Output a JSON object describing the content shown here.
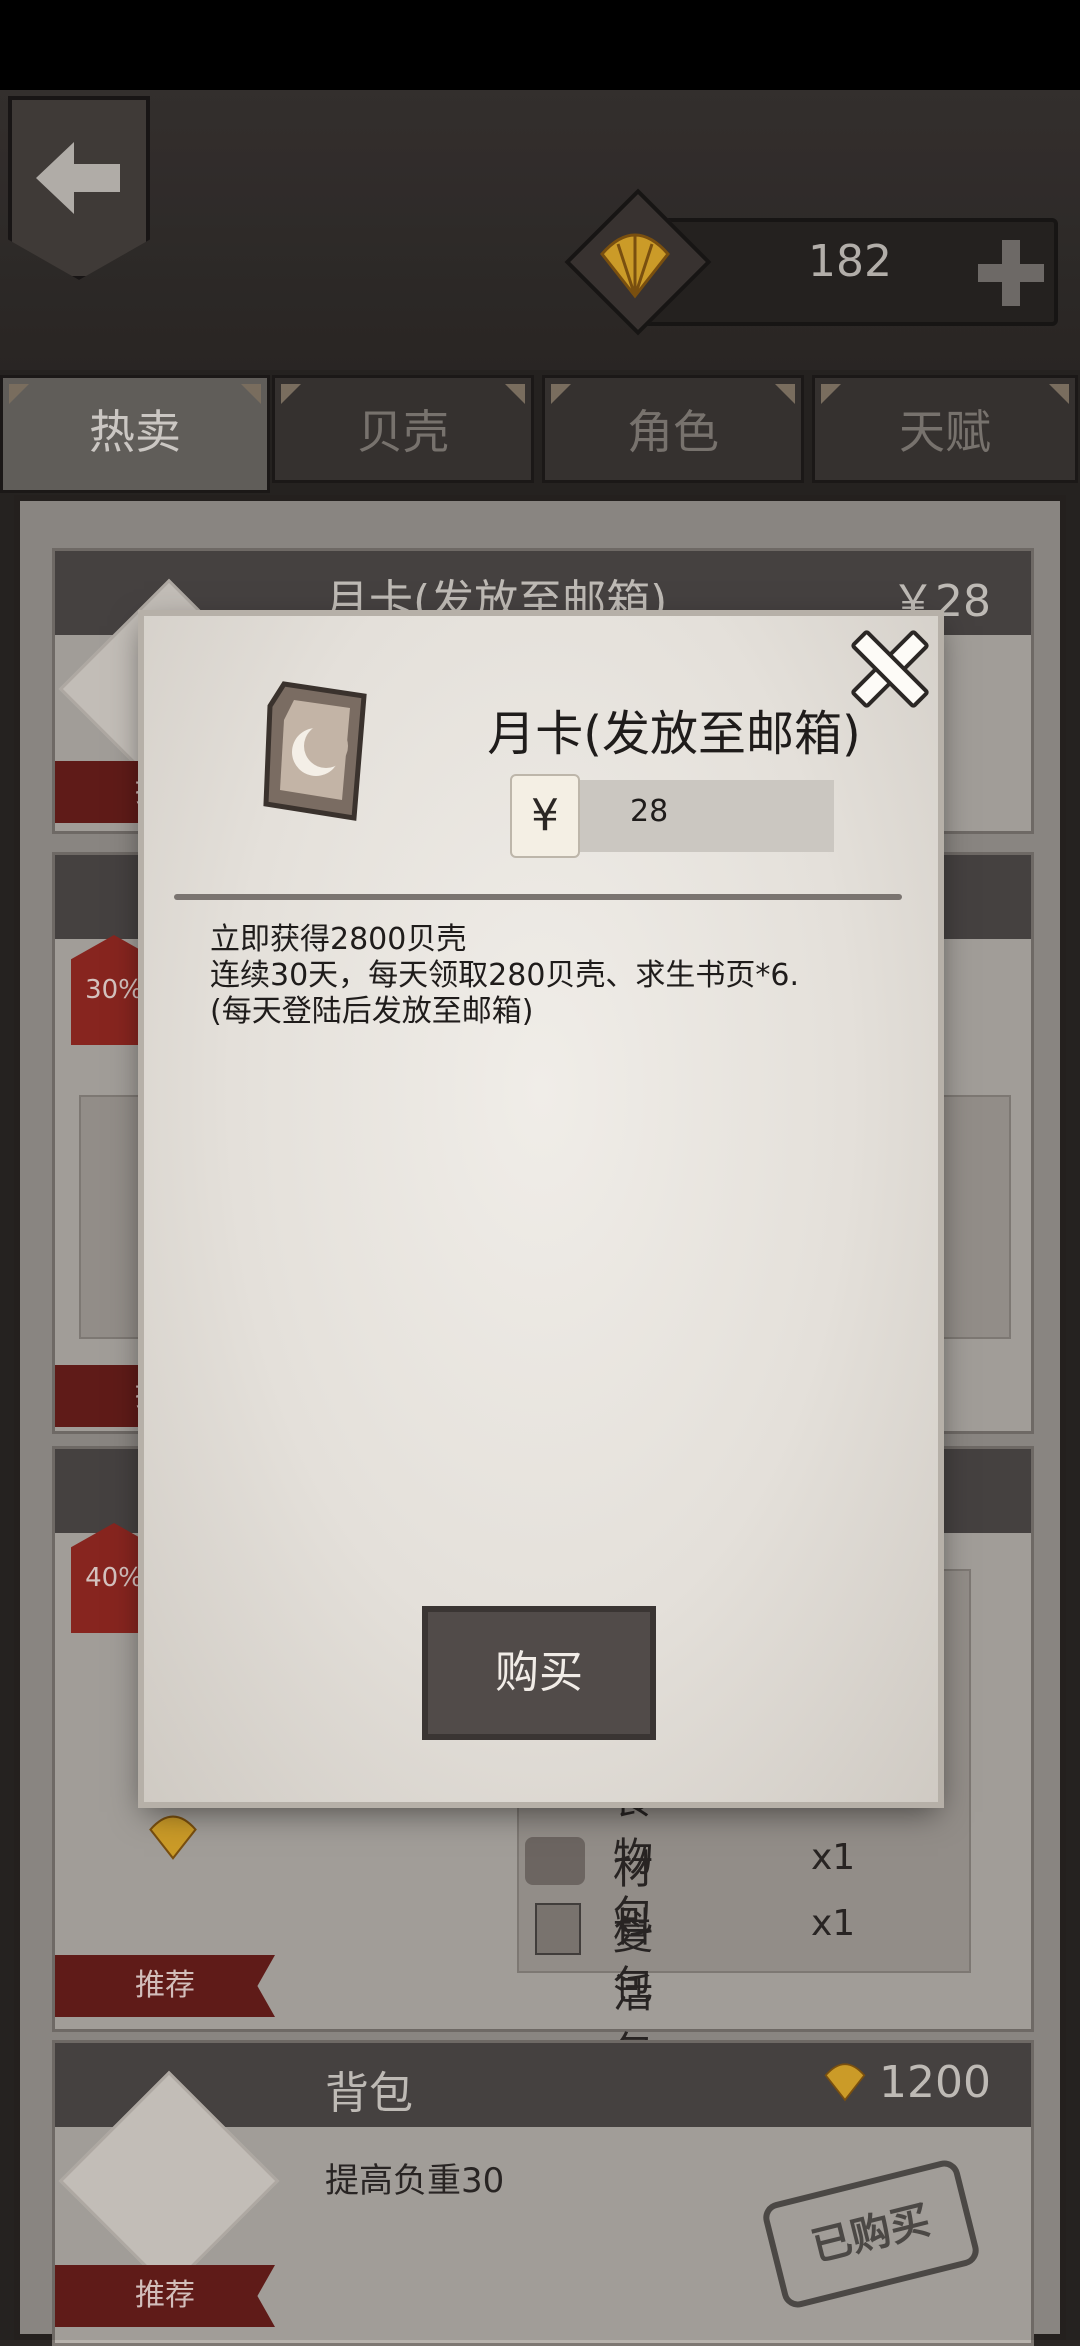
{
  "currency": {
    "value": "182"
  },
  "tabs": [
    {
      "label": "热卖"
    },
    {
      "label": "贝壳"
    },
    {
      "label": "角色"
    },
    {
      "label": "天赋"
    }
  ],
  "cards": {
    "monthly": {
      "title": "月卡(发放至邮箱)",
      "price": "￥28",
      "ribbon": "推荐"
    },
    "sale1": {
      "discount": "30%",
      "ribbon": "推荐"
    },
    "sale2": {
      "discount": "40%",
      "ribbon": "推荐",
      "items": [
        {
          "label": "食物包",
          "qty": "x1"
        },
        {
          "label": "材料包",
          "qty": "x1"
        },
        {
          "label": "复活包",
          "qty": "x1"
        }
      ]
    },
    "backpack": {
      "title": "背包",
      "price": "1200",
      "desc": "提高负重30",
      "ribbon": "推荐",
      "stamp": "已购买"
    }
  },
  "modal": {
    "title": "月卡(发放至邮箱)",
    "currency_symbol": "¥",
    "price": "28",
    "description": [
      "立即获得2800贝壳",
      "连续30天，每天领取280贝壳、求生书页*6.",
      "(每天登陆后发放至邮箱)"
    ],
    "buy_label": "购买"
  }
}
